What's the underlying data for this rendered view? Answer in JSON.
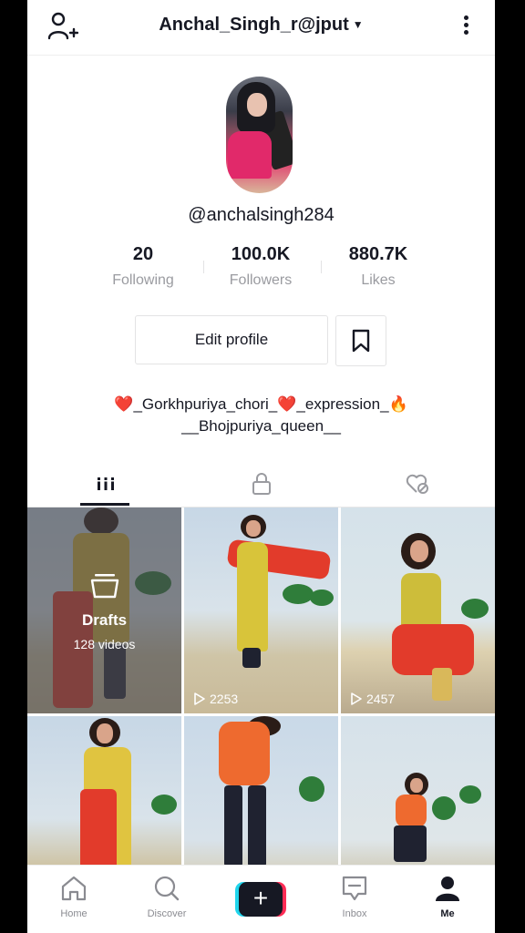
{
  "header": {
    "username": "Anchal_Singh_r@jput",
    "dropdown_icon": "caret-down-icon",
    "add_user_icon": "add-user-icon",
    "more_icon": "more-vertical-icon"
  },
  "profile": {
    "handle": "@anchalsingh284",
    "stats": [
      {
        "value": "20",
        "label": "Following"
      },
      {
        "value": "100.0K",
        "label": "Followers"
      },
      {
        "value": "880.7K",
        "label": "Likes"
      }
    ],
    "edit_label": "Edit profile",
    "bio_line1_parts": [
      "❤️",
      "_Gorkhpuriya_chori_",
      "❤️",
      "_expression_",
      "🔥"
    ],
    "bio_line2": "__Bhojpuriya_queen__"
  },
  "tabs": [
    {
      "icon": "videos-grid-icon",
      "active": true
    },
    {
      "icon": "lock-icon",
      "active": false
    },
    {
      "icon": "liked-heart-icon",
      "active": false
    }
  ],
  "grid": {
    "drafts_label": "Drafts",
    "drafts_count": "128 videos",
    "videos": [
      {
        "views": "2253"
      },
      {
        "views": "2457"
      },
      {
        "views": ""
      },
      {
        "views": ""
      },
      {
        "views": ""
      }
    ]
  },
  "bottom_nav": [
    {
      "label": "Home",
      "icon": "home-icon"
    },
    {
      "label": "Discover",
      "icon": "search-icon"
    },
    {
      "label": "",
      "icon": "plus-icon"
    },
    {
      "label": "Inbox",
      "icon": "inbox-icon"
    },
    {
      "label": "Me",
      "icon": "profile-icon",
      "active": true
    }
  ],
  "colors": {
    "text": "#161823",
    "muted": "#9a9ba0",
    "heart": "#e5212a",
    "create_cyan": "#20d5ec",
    "create_red": "#fe2c55"
  }
}
